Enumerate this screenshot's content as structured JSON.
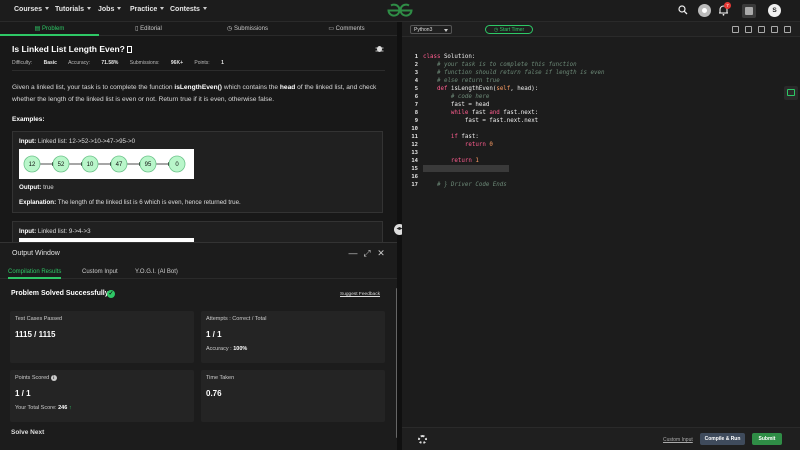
{
  "nav": {
    "items": [
      {
        "label": "Courses"
      },
      {
        "label": "Tutorials"
      },
      {
        "label": "Jobs"
      },
      {
        "label": "Practice"
      },
      {
        "label": "Contests"
      }
    ],
    "notification_count": "7",
    "avatar_letter": "S"
  },
  "tabs": [
    "Problem",
    "Editorial",
    "Submissions",
    "Comments"
  ],
  "problem": {
    "title": "Is Linked List Length Even?",
    "difficulty_label": "Difficulty:",
    "difficulty": "Basic",
    "accuracy_label": "Accuracy:",
    "accuracy": "71.58%",
    "submissions_label": "Submissions:",
    "submissions": "96K+",
    "points_label": "Points:",
    "points": "1",
    "desc_1": "Given a linked list, your task is to complete the function ",
    "desc_fn": "isLengthEven()",
    "desc_2": " which contains the ",
    "desc_head": "head",
    "desc_3": " of the linked list, and check whether the length of the linked list is even or not. Return true if it is even, otherwise false.",
    "examples_heading": "Examples:",
    "examples": [
      {
        "input_label": "Input:",
        "input_text": "Linked list: 12->52->10->47->95->0",
        "nodes": [
          "12",
          "52",
          "10",
          "47",
          "95",
          "0"
        ],
        "output_label": "Output:",
        "output_text": "true",
        "explanation_label": "Explanation:",
        "explanation_text": "The length of the linked list is 6 which is even, hence returned true."
      },
      {
        "input_label": "Input:",
        "input_text": "Linked list: 9->4->3"
      }
    ]
  },
  "output_window": {
    "title": "Output Window",
    "tabs": [
      "Compilation Results",
      "Custom Input",
      "Y.O.G.I. (AI Bot)"
    ],
    "status": "Problem Solved Successfully",
    "feedback": "Suggest Feedback",
    "test_cases_label": "Test Cases Passed",
    "test_cases_value": "1115 / 1115",
    "attempts_label": "Attempts : Correct / Total",
    "attempts_value": "1 / 1",
    "accuracy_label": "Accuracy :",
    "accuracy_value": "100%",
    "points_label": "Points Scored",
    "points_value": "1 / 1",
    "total_score_label": "Your Total Score:",
    "total_score_value": "246",
    "time_label": "Time Taken",
    "time_value": "0.76",
    "solve_next": "Solve Next"
  },
  "editor": {
    "language": "Python3",
    "timer": "Start Timer",
    "lines": [
      {
        "n": "1",
        "html": "<span class='kw'>class</span> Solution:"
      },
      {
        "n": "2",
        "html": "    <span class='cm'># your task is to complete this function</span>"
      },
      {
        "n": "3",
        "html": "    <span class='cm'># function should return false if length is even</span>"
      },
      {
        "n": "4",
        "html": "    <span class='cm'># else return true</span>"
      },
      {
        "n": "5",
        "html": "    <span class='kw'>def</span> isLengthEven(<span class='sl'>self</span>, head):"
      },
      {
        "n": "6",
        "html": "        <span class='cm'># code here</span>"
      },
      {
        "n": "7",
        "html": "        fast = head"
      },
      {
        "n": "8",
        "html": "        <span class='kw'>while</span> fast <span class='kw'>and</span> fast.next:"
      },
      {
        "n": "9",
        "html": "            fast = fast.next.next"
      },
      {
        "n": "10",
        "html": ""
      },
      {
        "n": "11",
        "html": "        <span class='kw'>if</span> fast:"
      },
      {
        "n": "12",
        "html": "            <span class='kw'>return</span> <span class='num'>0</span>"
      },
      {
        "n": "13",
        "html": ""
      },
      {
        "n": "14",
        "html": "        <span class='kw'>return</span> <span class='num'>1</span>"
      },
      {
        "n": "15",
        "html": ""
      },
      {
        "n": "16",
        "html": ""
      },
      {
        "n": "17",
        "html": "<span class='cm'>    # } Driver Code Ends</span>"
      }
    ],
    "custom_input": "Custom Input",
    "compile_label": "Compile & Run",
    "submit_label": "Submit"
  }
}
